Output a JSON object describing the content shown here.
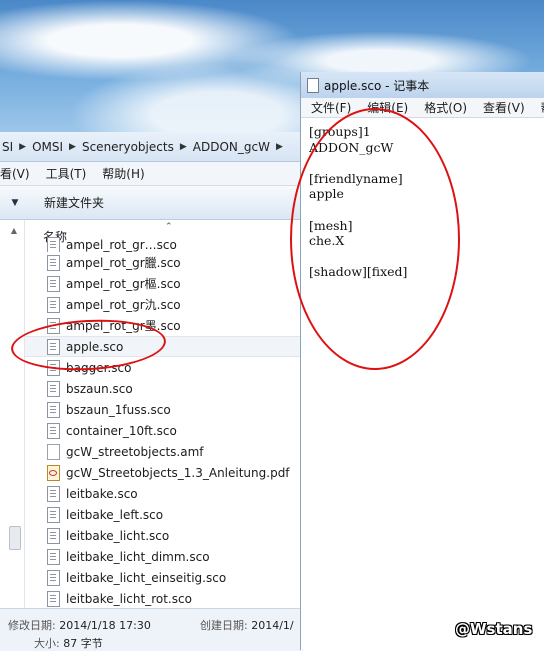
{
  "explorer": {
    "breadcrumb": [
      "SI",
      "OMSI",
      "Sceneryobjects",
      "ADDON_gcW"
    ],
    "menu": [
      "看(V)",
      "工具(T)",
      "帮助(H)"
    ],
    "toolbar": {
      "new_folder": "新建文件夹"
    },
    "column_name": "名称",
    "files": [
      {
        "name": "ampel_rot_gr…sco",
        "type": "sco",
        "clipped": true
      },
      {
        "name": "ampel_rot_gr臘.sco",
        "type": "sco"
      },
      {
        "name": "ampel_rot_gr樞.sco",
        "type": "sco"
      },
      {
        "name": "ampel_rot_gr氿.sco",
        "type": "sco"
      },
      {
        "name": "ampel_rot_gr墨.sco",
        "type": "sco"
      },
      {
        "name": "apple.sco",
        "type": "sco",
        "selected": true
      },
      {
        "name": "bagger.sco",
        "type": "sco"
      },
      {
        "name": "bszaun.sco",
        "type": "sco"
      },
      {
        "name": "bszaun_1fuss.sco",
        "type": "sco"
      },
      {
        "name": "container_10ft.sco",
        "type": "sco"
      },
      {
        "name": "gcW_streetobjects.amf",
        "type": "blank"
      },
      {
        "name": "gcW_Streetobjects_1.3_Anleitung.pdf",
        "type": "pdf"
      },
      {
        "name": "leitbake.sco",
        "type": "sco"
      },
      {
        "name": "leitbake_left.sco",
        "type": "sco"
      },
      {
        "name": "leitbake_licht.sco",
        "type": "sco"
      },
      {
        "name": "leitbake_licht_dimm.sco",
        "type": "sco"
      },
      {
        "name": "leitbake_licht_einseitig.sco",
        "type": "sco"
      },
      {
        "name": "leitbake_licht_rot.sco",
        "type": "sco"
      }
    ],
    "details": {
      "modified_label": "修改日期:",
      "modified_value": "2014/1/18 17:30",
      "created_label": "创建日期:",
      "created_value": "2014/1/",
      "size_label": "大小:",
      "size_value": "87 字节"
    }
  },
  "notepad": {
    "title": "apple.sco - 记事本",
    "menu": [
      "文件(F)",
      "编辑(E)",
      "格式(O)",
      "查看(V)",
      "帮助"
    ],
    "content": "[groups]1\nADDON_gcW\n\n[friendlyname]\napple\n\n[mesh]\nche.X\n\n[shadow][fixed]"
  },
  "watermark": "@Wstans",
  "colors": {
    "annotation": "#dd1111"
  }
}
